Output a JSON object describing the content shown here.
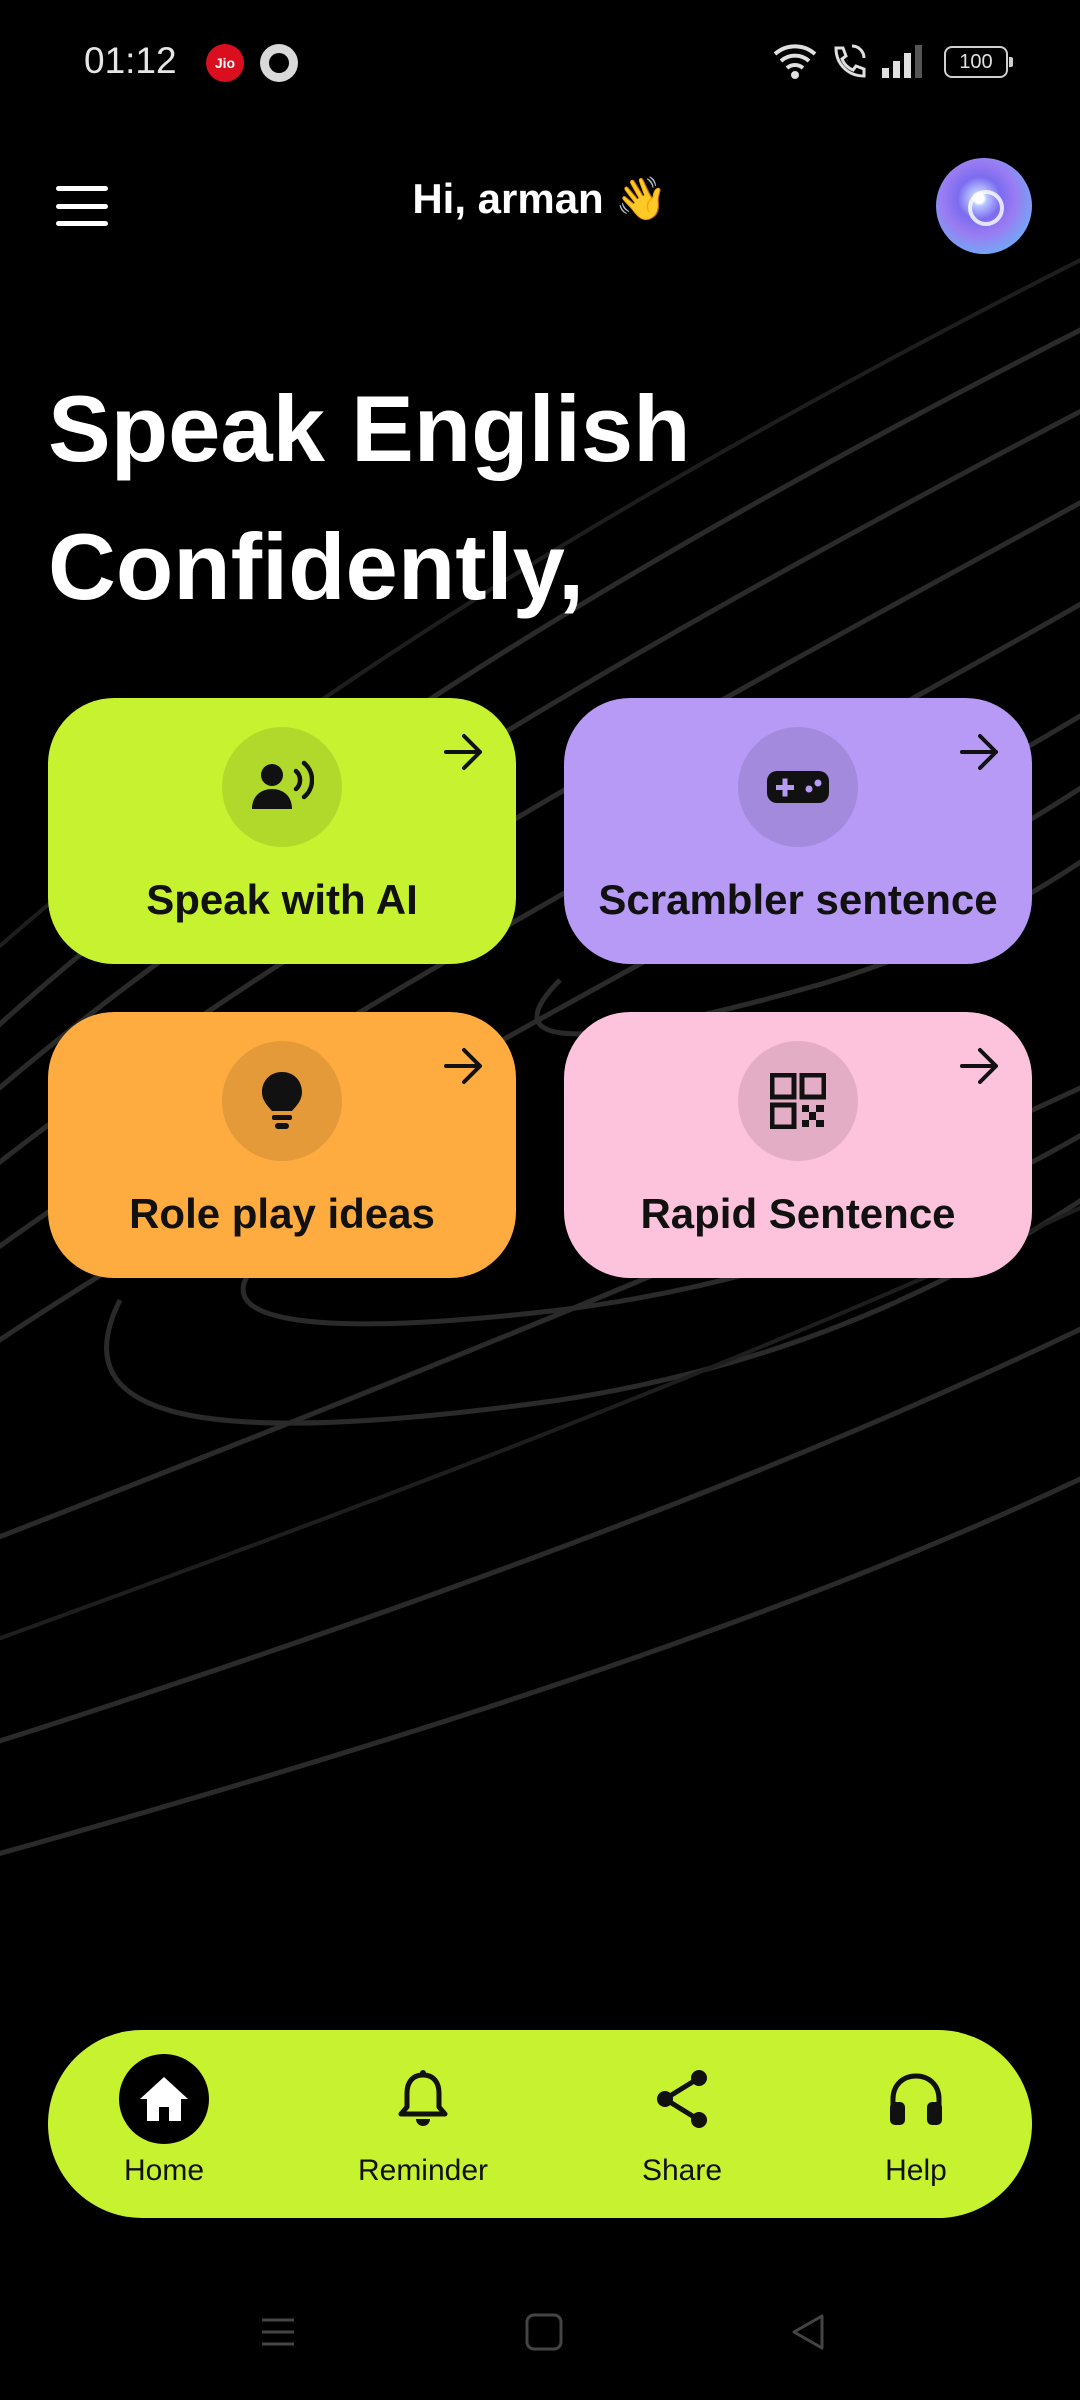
{
  "status_bar": {
    "time": "01:12",
    "carrier_icon_label": "Jio",
    "battery": "100",
    "icons": [
      "jio-icon",
      "app-status-icon",
      "wifi-icon",
      "call-icon",
      "signal-icon",
      "battery-icon"
    ]
  },
  "header": {
    "greeting": "Hi, arman 👋",
    "menu_icon": "hamburger-menu-icon",
    "avatar_icon": "ai-orb-avatar"
  },
  "hero": {
    "line1": "Speak English",
    "line2": "Confidently,"
  },
  "cards": [
    {
      "label": "Speak with AI",
      "icon": "voice-person-icon",
      "color": "#c6f230"
    },
    {
      "label": "Scrambler sentence",
      "icon": "gamepad-icon",
      "color": "#b69af5"
    },
    {
      "label": "Role play ideas",
      "icon": "lightbulb-icon",
      "color": "#feac40"
    },
    {
      "label": "Rapid Sentence",
      "icon": "qr-code-icon",
      "color": "#fdc2dc"
    }
  ],
  "bottom_nav": {
    "color": "#c6f230",
    "items": [
      {
        "label": "Home",
        "icon": "home-icon",
        "active": true
      },
      {
        "label": "Reminder",
        "icon": "bell-icon",
        "active": false
      },
      {
        "label": "Share",
        "icon": "share-icon",
        "active": false
      },
      {
        "label": "Help",
        "icon": "headphones-icon",
        "active": false
      }
    ]
  },
  "system_nav": [
    "recents-icon",
    "home-square-icon",
    "back-triangle-icon"
  ]
}
